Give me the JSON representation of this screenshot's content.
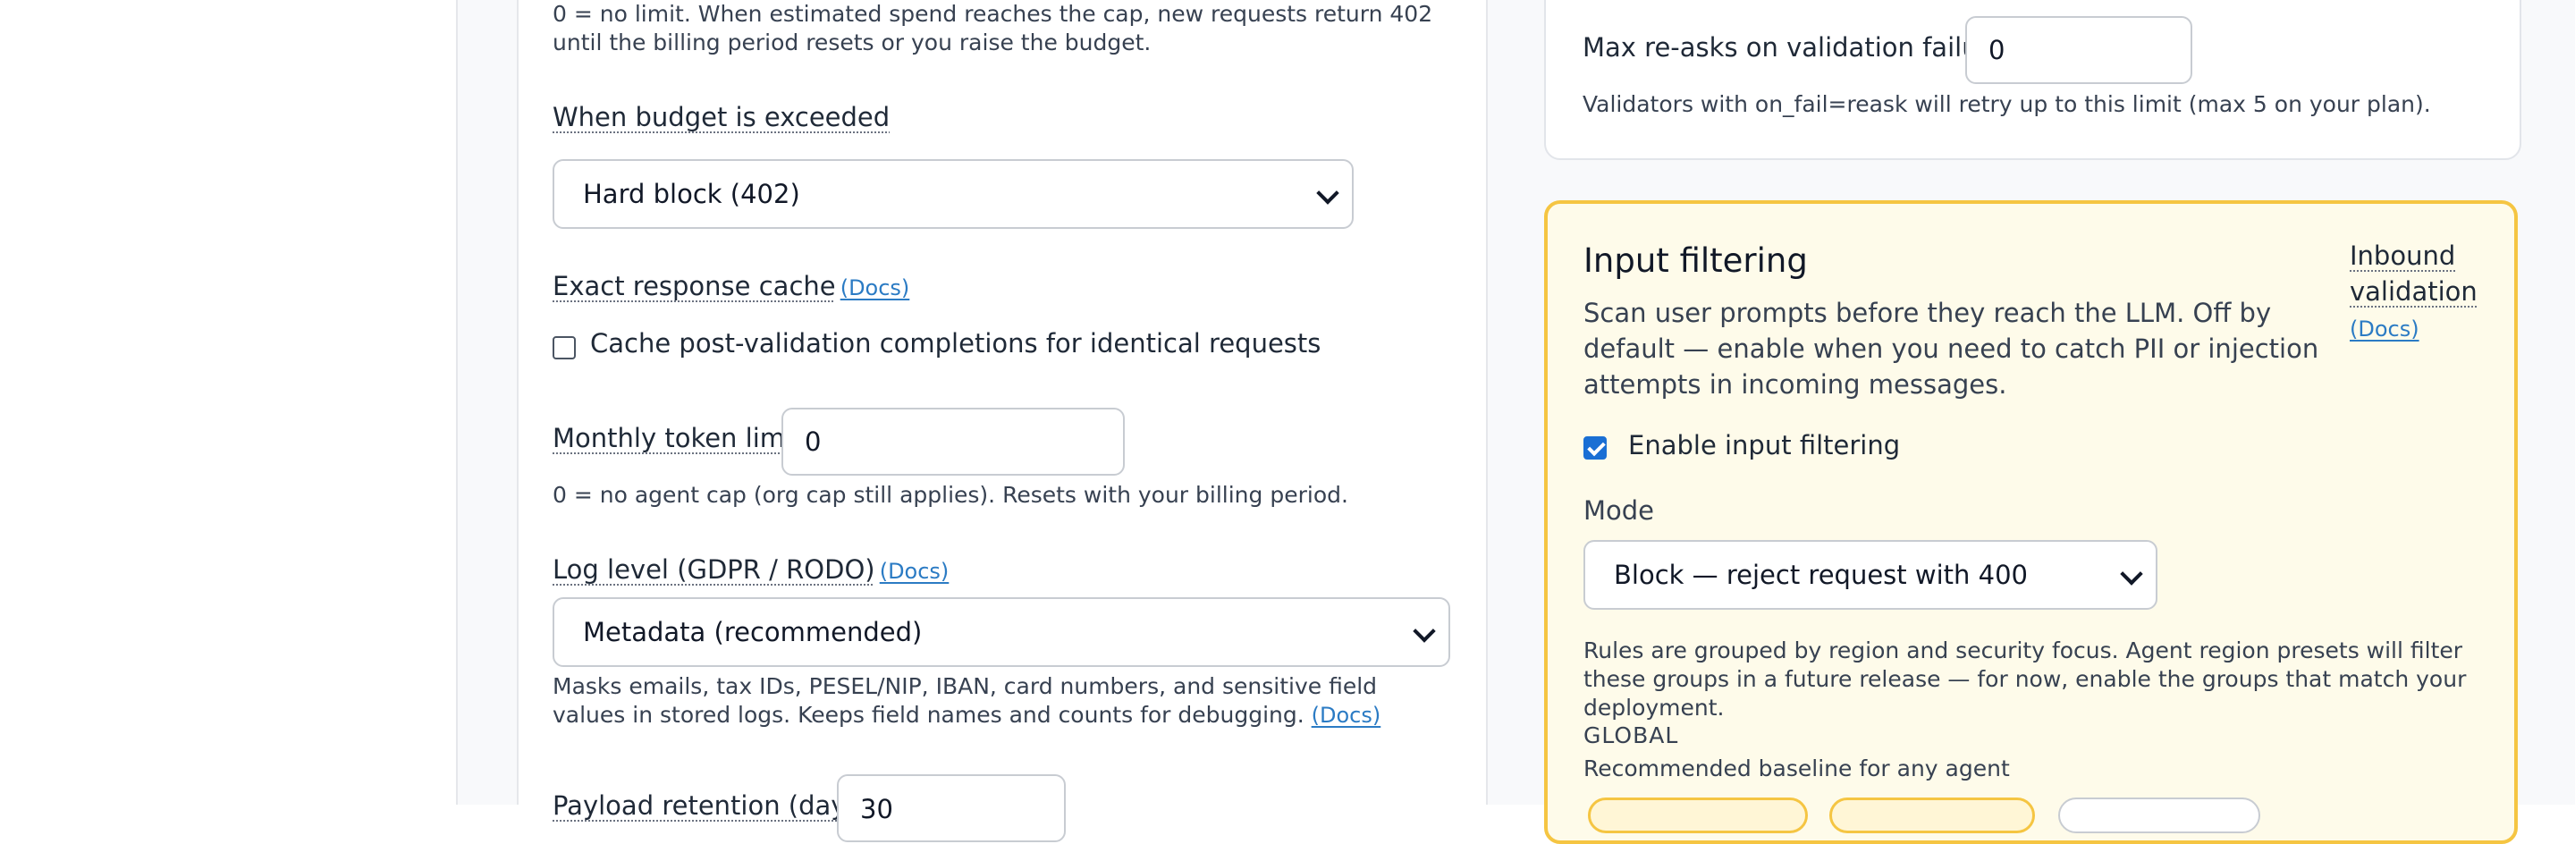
{
  "budget": {
    "cap_helper": "0 = no limit. When estimated spend reaches the cap, new requests return 402 until the billing period resets or you raise the budget.",
    "exceeded_label": "When budget is exceeded",
    "exceeded_value": "Hard block (402)"
  },
  "cache": {
    "label": "Exact response cache",
    "docs": "(Docs)",
    "checkbox_label": "Cache post-validation completions for identical requests",
    "checked": false
  },
  "token_limit": {
    "label": "Monthly token limit",
    "value": "0",
    "helper": "0 = no agent cap (org cap still applies). Resets with your billing period."
  },
  "log_level": {
    "label": "Log level (GDPR / RODO)",
    "docs": "(Docs)",
    "value": "Metadata (recommended)",
    "helper": "Masks emails, tax IDs, PESEL/NIP, IBAN, card numbers, and sensitive field values in stored logs. Keeps field names and counts for debugging.",
    "helper_docs": "(Docs)"
  },
  "retention": {
    "label": "Payload retention (days)",
    "value": "30"
  },
  "reask": {
    "label": "Max re-asks on validation failure",
    "value": "0",
    "helper": "Validators with on_fail=reask will retry up to this limit (max 5 on your plan)."
  },
  "input_filtering": {
    "title": "Input filtering",
    "description": "Scan user prompts before they reach the LLM. Off by default — enable when you need to catch PII or injection attempts in incoming messages.",
    "side_link_line1": "Inbound",
    "side_link_line2": "validation",
    "side_docs": "(Docs)",
    "enable_label": "Enable input filtering",
    "enabled": true,
    "mode_label": "Mode",
    "mode_value": "Block — reject request with 400",
    "rules_helper": "Rules are grouped by region and security focus. Agent region presets will filter these groups in a future release — for now, enable the groups that match your deployment.",
    "group_heading": "GLOBAL",
    "group_subtitle": "Recommended baseline for any agent"
  },
  "colors": {
    "accent": "#1a6fd4",
    "link": "#2b7bc4",
    "warning_border": "#f5c542",
    "warning_bg": "#fefbea"
  }
}
